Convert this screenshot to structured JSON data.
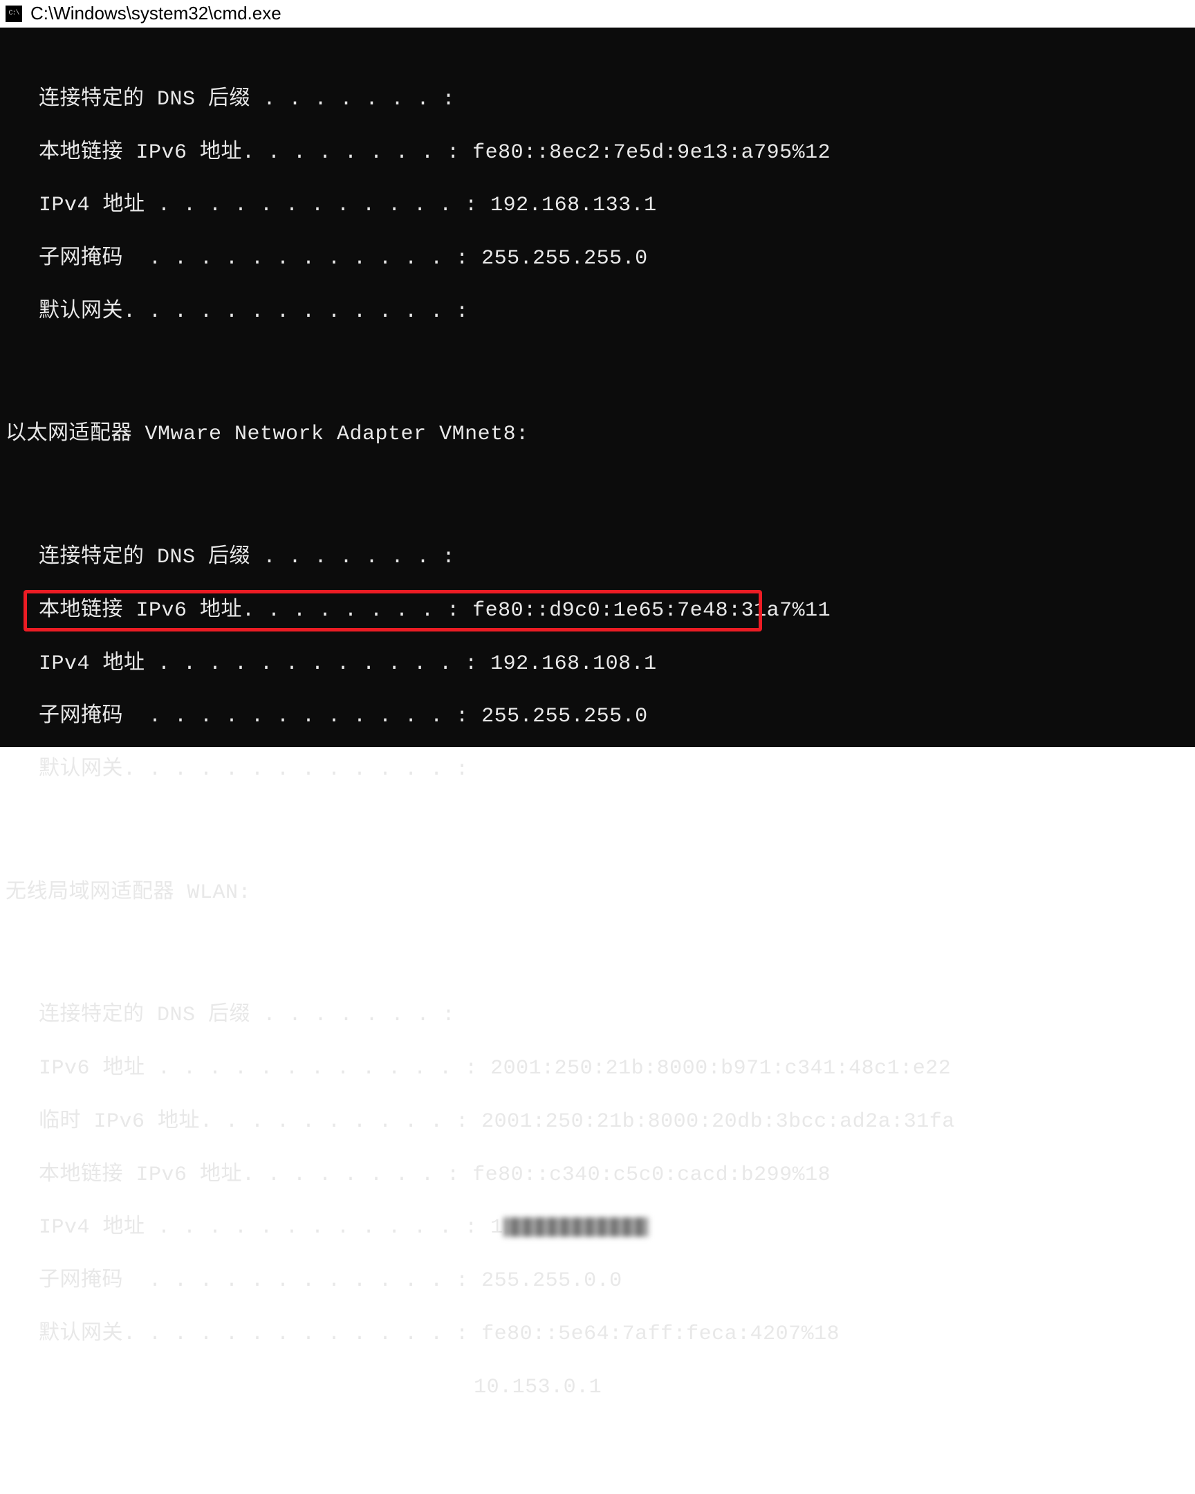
{
  "titlebar": {
    "icon_label": "C:\\",
    "title": "C:\\Windows\\system32\\cmd.exe"
  },
  "block1": {
    "dns_suffix_label": "连接特定的 DNS 后缀 . . . . . . . :",
    "dns_suffix_value": "",
    "ipv6_local_label": "本地链接 IPv6 地址. . . . . . . . :",
    "ipv6_local_value": " fe80::8ec2:7e5d:9e13:a795%12",
    "ipv4_label": "IPv4 地址 . . . . . . . . . . . . :",
    "ipv4_value": " 192.168.133.1",
    "subnet_label": "子网掩码  . . . . . . . . . . . . :",
    "subnet_value": " 255.255.255.0",
    "gateway_label": "默认网关. . . . . . . . . . . . . :",
    "gateway_value": ""
  },
  "block2": {
    "header": "以太网适配器 VMware Network Adapter VMnet8:",
    "dns_suffix_label": "连接特定的 DNS 后缀 . . . . . . . :",
    "dns_suffix_value": "",
    "ipv6_local_label": "本地链接 IPv6 地址. . . . . . . . :",
    "ipv6_local_value": " fe80::d9c0:1e65:7e48:31a7%11",
    "ipv4_label": "IPv4 地址 . . . . . . . . . . . . :",
    "ipv4_value": " 192.168.108.1",
    "subnet_label": "子网掩码  . . . . . . . . . . . . :",
    "subnet_value": " 255.255.255.0",
    "gateway_label": "默认网关. . . . . . . . . . . . . :",
    "gateway_value": ""
  },
  "block3": {
    "header": "无线局域网适配器 WLAN:",
    "dns_suffix_label": "连接特定的 DNS 后缀 . . . . . . . :",
    "dns_suffix_value": "",
    "ipv6_label": "IPv6 地址 . . . . . . . . . . . . :",
    "ipv6_value": " 2001:250:21b:8000:b971:c341:48c1:e22",
    "temp_ipv6_label": "临时 IPv6 地址. . . . . . . . . . :",
    "temp_ipv6_value": " 2001:250:21b:8000:20db:3bcc:ad2a:31fa",
    "ipv6_local_label": "本地链接 IPv6 地址. . . . . . . . :",
    "ipv6_local_value": " fe80::c340:c5c0:cacd:b299%18",
    "ipv4_label": "IPv4 地址 . . . . . . . . . . . . :",
    "ipv4_value_prefix": " 1",
    "subnet_label": "子网掩码  . . . . . . . . . . . . :",
    "subnet_value": " 255.255.0.0",
    "gateway_label": "默认网关. . . . . . . . . . . . . :",
    "gateway_value": " fe80::5e64:7aff:feca:4207%18",
    "gateway_value2": "10.153.0.1"
  }
}
